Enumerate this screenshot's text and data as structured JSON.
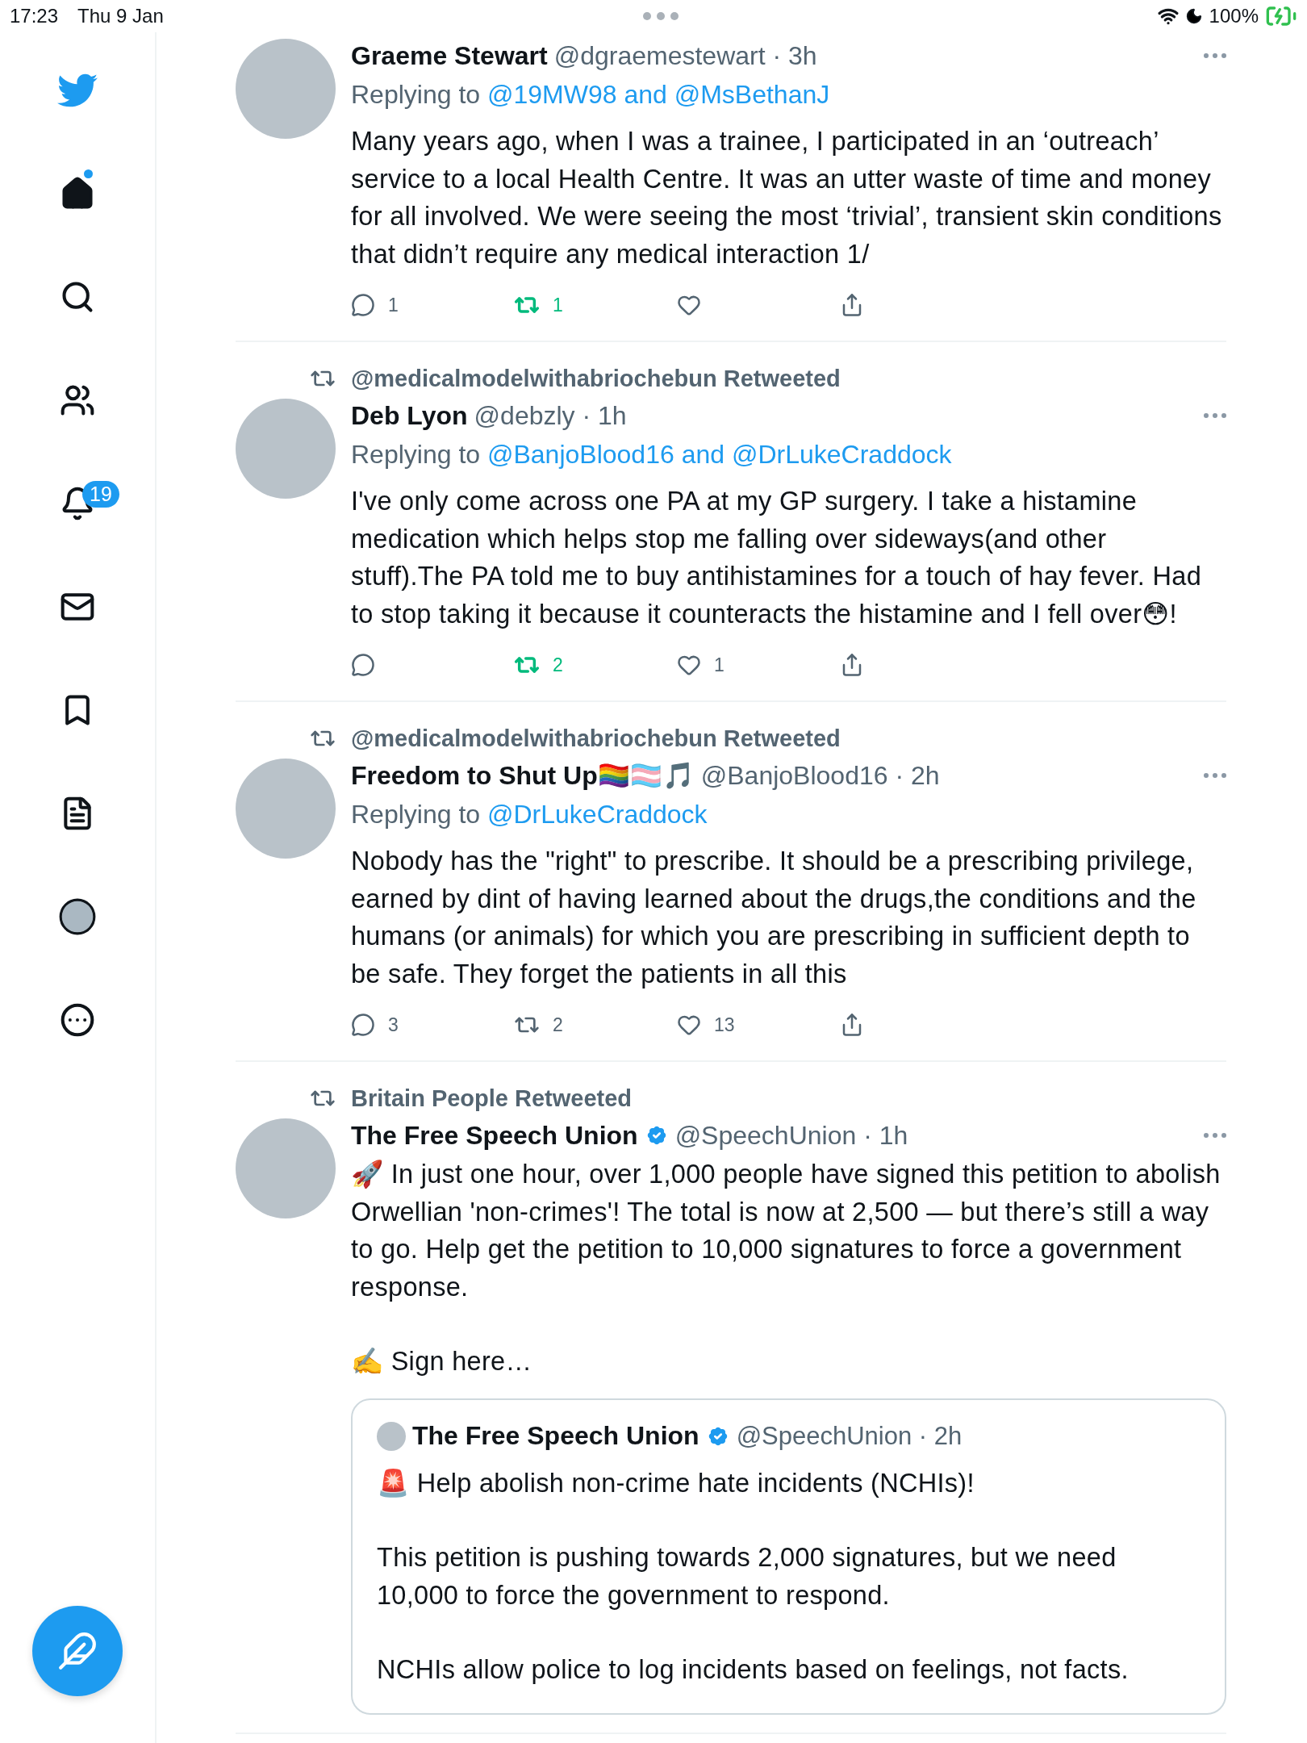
{
  "status_bar": {
    "time": "17:23",
    "date": "Thu 9 Jan",
    "battery": "100%"
  },
  "sidebar": {
    "items": [
      {
        "kind": "logo"
      },
      {
        "kind": "home",
        "unread": true
      },
      {
        "kind": "search"
      },
      {
        "kind": "people"
      },
      {
        "kind": "notifications",
        "badge": "19"
      },
      {
        "kind": "messages"
      },
      {
        "kind": "bookmarks"
      },
      {
        "kind": "lists"
      },
      {
        "kind": "profile"
      },
      {
        "kind": "more"
      }
    ]
  },
  "tweets": [
    {
      "name": "Graeme Stewart",
      "verified": false,
      "meta": "@dgraemestewart · 3h",
      "replying_to": {
        "label": "Replying to",
        "handles": "@19MW98 and @MsBethanJ"
      },
      "paragraphs": [
        "Many years ago, when I was a trainee, I participated in an ‘outreach’ service to a local Health Centre. It was an utter waste of time and money for all involved. We were seeing the most ‘trivial’, transient skin conditions that didn’t require any medical interaction 1/"
      ],
      "actions": {
        "replies": "1",
        "retweets": "1",
        "retweeted": true,
        "liked": false
      }
    },
    {
      "retweeted_by": "@medicalmodelwithabriochebun Retweeted",
      "name": "Deb Lyon",
      "verified": false,
      "meta": "@debzly · 1h",
      "replying_to": {
        "label": "Replying to",
        "handles": "@BanjoBlood16 and @DrLukeCraddock"
      },
      "paragraphs": [
        "I've only come across one PA at my GP surgery. I take a histamine medication which helps stop me falling over sideways(and other stuff).The PA told me to buy antihistamines for a touch of hay fever. Had to stop taking it because it counteracts the histamine and I fell over😳!"
      ],
      "actions": {
        "retweets": "2",
        "retweeted": true,
        "likes": "1",
        "liked": false
      }
    },
    {
      "retweeted_by": "@medicalmodelwithabriochebun Retweeted",
      "name": "Freedom to Shut Up🏳️‍🌈🏳️‍⚧️🎵",
      "verified": false,
      "meta": "@BanjoBlood16 · 2h",
      "replying_to": {
        "label": "Replying to",
        "handles": "@DrLukeCraddock"
      },
      "paragraphs": [
        "Nobody has the \"right\" to prescribe. It should be a prescribing privilege, earned by dint of having learned about the drugs,the conditions and the humans (or animals) for which you are prescribing in sufficient depth to be safe. They forget the patients in all this"
      ],
      "actions": {
        "replies": "3",
        "retweets": "2",
        "retweeted": false,
        "likes": "13",
        "liked": false
      }
    },
    {
      "retweeted_by": "Britain People Retweeted",
      "name": "The Free Speech Union",
      "verified": true,
      "meta": "@SpeechUnion · 1h",
      "paragraphs": [
        "🚀 In just one hour, over 1,000 people have signed this petition to abolish Orwellian 'non-crimes'! The total is now at 2,500 — but there’s still a way to go. Help get the petition to 10,000 signatures to force a government response.",
        "✍️ Sign here…"
      ],
      "quote": {
        "name": "The Free Speech Union",
        "verified": true,
        "meta": "@SpeechUnion · 2h",
        "paragraphs": [
          "🚨 Help abolish non-crime hate incidents (NCHIs)!",
          "This petition is pushing towards 2,000 signatures, but we need 10,000 to force the government to respond.",
          "NCHIs allow police to log incidents based on feelings, not facts."
        ]
      }
    }
  ]
}
